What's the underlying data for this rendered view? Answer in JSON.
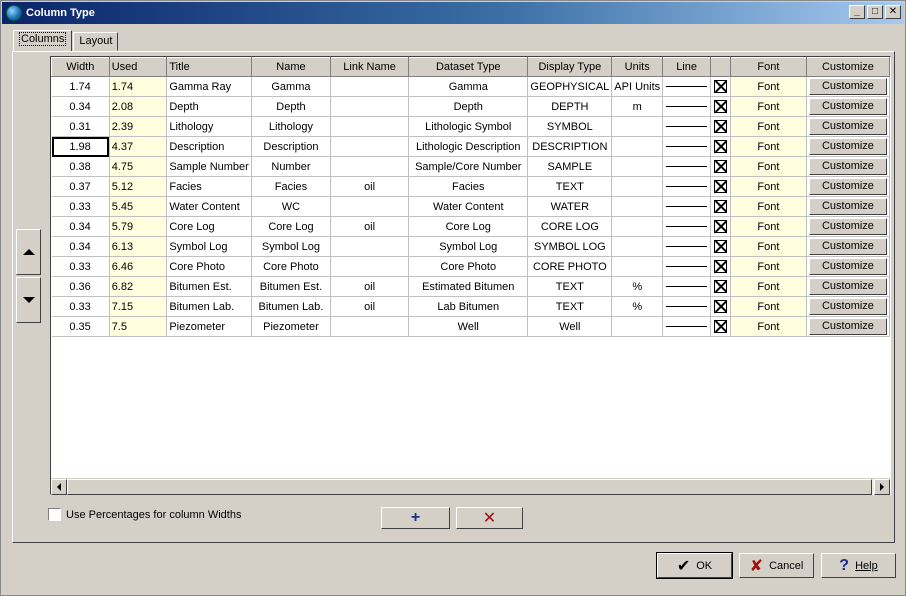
{
  "window": {
    "title": "Column Type",
    "minimize_glyph": "_",
    "maximize_glyph": "□",
    "close_glyph": "✕"
  },
  "tabs": [
    {
      "label": "Columns",
      "active": true
    },
    {
      "label": "Layout",
      "active": false
    }
  ],
  "table": {
    "headers": [
      "Width",
      "Used",
      "Title",
      "Name",
      "Link Name",
      "Dataset Type",
      "Display Type",
      "Units",
      "Line",
      "",
      "Font",
      "Customize"
    ],
    "rows": [
      {
        "width": "1.74",
        "used": "1.74",
        "title": "Gamma Ray",
        "name": "Gamma",
        "link": "",
        "dataset": "Gamma",
        "display": "GEOPHYSICAL",
        "units": "API Units",
        "font": "Font",
        "customize": "Customize"
      },
      {
        "width": "0.34",
        "used": "2.08",
        "title": "Depth",
        "name": "Depth",
        "link": "",
        "dataset": "Depth",
        "display": "DEPTH",
        "units": "m",
        "font": "Font",
        "customize": "Customize"
      },
      {
        "width": "0.31",
        "used": "2.39",
        "title": "Lithology",
        "name": "Lithology",
        "link": "",
        "dataset": "Lithologic Symbol",
        "display": "SYMBOL",
        "units": "",
        "font": "Font",
        "customize": "Customize"
      },
      {
        "width": "1.98",
        "used": "4.37",
        "title": "Description",
        "name": "Description",
        "link": "",
        "dataset": "Lithologic Description",
        "display": "DESCRIPTION",
        "units": "",
        "font": "Font",
        "customize": "Customize"
      },
      {
        "width": "0.38",
        "used": "4.75",
        "title": "Sample Number",
        "name": "Number",
        "link": "",
        "dataset": "Sample/Core Number",
        "display": "SAMPLE",
        "units": "",
        "font": "Font",
        "customize": "Customize"
      },
      {
        "width": "0.37",
        "used": "5.12",
        "title": "Facies",
        "name": "Facies",
        "link": "oil",
        "dataset": "Facies",
        "display": "TEXT",
        "units": "",
        "font": "Font",
        "customize": "Customize"
      },
      {
        "width": "0.33",
        "used": "5.45",
        "title": "Water Content",
        "name": "WC",
        "link": "",
        "dataset": "Water Content",
        "display": "WATER",
        "units": "",
        "font": "Font",
        "customize": "Customize"
      },
      {
        "width": "0.34",
        "used": "5.79",
        "title": "Core Log",
        "name": "Core Log",
        "link": "oil",
        "dataset": "Core Log",
        "display": "CORE LOG",
        "units": "",
        "font": "Font",
        "customize": "Customize"
      },
      {
        "width": "0.34",
        "used": "6.13",
        "title": "Symbol Log",
        "name": "Symbol Log",
        "link": "",
        "dataset": "Symbol Log",
        "display": "SYMBOL LOG",
        "units": "",
        "font": "Font",
        "customize": "Customize"
      },
      {
        "width": "0.33",
        "used": "6.46",
        "title": "Core Photo",
        "name": "Core Photo",
        "link": "",
        "dataset": "Core Photo",
        "display": "CORE PHOTO",
        "units": "",
        "font": "Font",
        "customize": "Customize"
      },
      {
        "width": "0.36",
        "used": "6.82",
        "title": "Bitumen Est.",
        "name": "Bitumen Est.",
        "link": "oil",
        "dataset": "Estimated Bitumen",
        "display": "TEXT",
        "units": "%",
        "font": "Font",
        "customize": "Customize"
      },
      {
        "width": "0.33",
        "used": "7.15",
        "title": "Bitumen Lab.",
        "name": "Bitumen Lab.",
        "link": "oil",
        "dataset": "Lab Bitumen",
        "display": "TEXT",
        "units": "%",
        "font": "Font",
        "customize": "Customize"
      },
      {
        "width": "0.35",
        "used": "7.5",
        "title": "Piezometer",
        "name": "Piezometer",
        "link": "",
        "dataset": "Well",
        "display": "Well",
        "units": "",
        "font": "Font",
        "customize": "Customize"
      }
    ]
  },
  "options": {
    "use_percentages_label": "Use Percentages for column Widths",
    "use_percentages_checked": false
  },
  "actions": {
    "add_glyph": "+",
    "delete_glyph": "✕"
  },
  "buttons": {
    "ok": "OK",
    "cancel": "Cancel",
    "help": "Help"
  },
  "colors": {
    "highlight_cell": "#ffffe0",
    "add_color": "#1a2e8a",
    "delete_color": "#a01010"
  }
}
